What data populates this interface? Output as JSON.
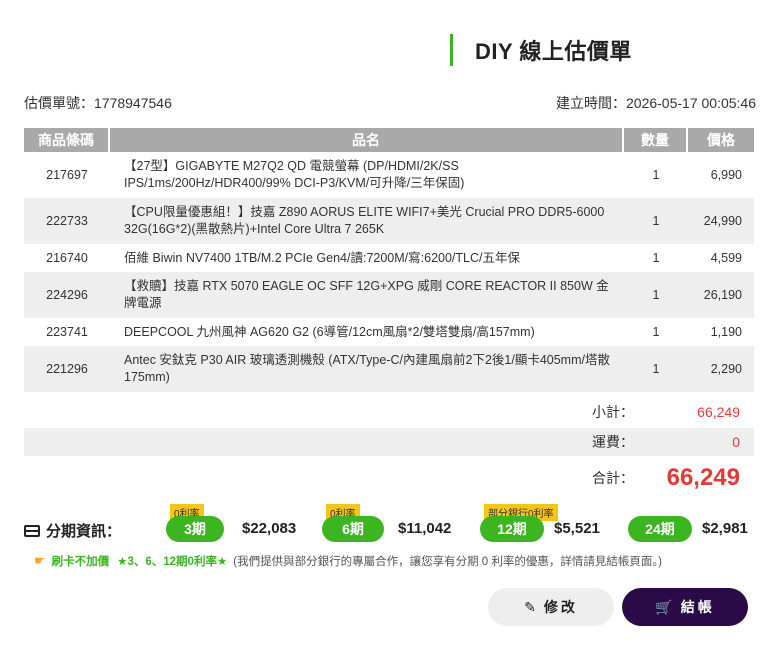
{
  "header": {
    "title": "DIY 線上估價單"
  },
  "meta": {
    "quote_no": "估價單號：1778947546",
    "created": "建立時間：2026-05-17 00:05:46"
  },
  "table": {
    "headers": {
      "code": "商品條碼",
      "name": "品名",
      "qty": "數量",
      "price": "價格"
    },
    "rows": [
      {
        "code": "217697",
        "name": "【27型】GIGABYTE M27Q2 QD 電競螢幕 (DP/HDMI/2K/SS IPS/1ms/200Hz/HDR400/99% DCI-P3/KVM/可升降/三年保固)",
        "qty": "1",
        "price": "6,990"
      },
      {
        "code": "222733",
        "name": "【CPU限量優惠組！】技嘉 Z890 AORUS ELITE WIFI7+美光 Crucial PRO DDR5-6000 32G(16G*2)(黑散熱片)+Intel Core Ultra 7 265K",
        "qty": "1",
        "price": "24,990"
      },
      {
        "code": "216740",
        "name": "佰維 Biwin NV7400 1TB/M.2 PCIe Gen4/讀:7200M/寫:6200/TLC/五年保",
        "qty": "1",
        "price": "4,599"
      },
      {
        "code": "224296",
        "name": "【救贖】技嘉 RTX 5070 EAGLE OC SFF 12G+XPG 威剛 CORE REACTOR II 850W 金牌電源",
        "qty": "1",
        "price": "26,190"
      },
      {
        "code": "223741",
        "name": "DEEPCOOL 九州風神 AG620 G2 (6導管/12cm風扇*2/雙塔雙扇/高157mm)",
        "qty": "1",
        "price": "1,190"
      },
      {
        "code": "221296",
        "name": "Antec 安鈦克 P30 AIR 玻璃透測機殼 (ATX/Type-C/內建風扇前2下2後1/顯卡405mm/塔散175mm)",
        "qty": "1",
        "price": "2,290"
      }
    ]
  },
  "summary": {
    "subtotal_label": "小計：",
    "subtotal": "66,249",
    "shipping_label": "運費：",
    "shipping": "0",
    "total_label": "合計：",
    "total": "66,249"
  },
  "installments": {
    "label": "分期資訊：",
    "plans": [
      {
        "tag": "0利率",
        "period": "3期",
        "amount": "$22,083"
      },
      {
        "tag": "0利率",
        "period": "6期",
        "amount": "$11,042"
      },
      {
        "tag": "部分銀行0利率",
        "period": "12期",
        "amount": "$5,521"
      },
      {
        "tag": "",
        "period": "24期",
        "amount": "$2,981"
      }
    ]
  },
  "note": {
    "no_markup": "刷卡不加價",
    "rate": "★3、6、12期0利率★",
    "text": "(我們提供與部分銀行的專屬合作，讓您享有分期 0 利率的優惠，詳情請見結帳頁面。)"
  },
  "buttons": {
    "edit": "修改",
    "checkout": "結帳"
  },
  "colors": {
    "accent_green": "#3cb521",
    "total_red": "#e53935",
    "checkout_bg": "#2a0b47",
    "tag_yellow": "#f5c518"
  },
  "icons": {
    "card": "credit-card-icon",
    "hand": "pointing-hand-icon",
    "pencil": "pencil-icon",
    "cart": "cart-icon"
  }
}
